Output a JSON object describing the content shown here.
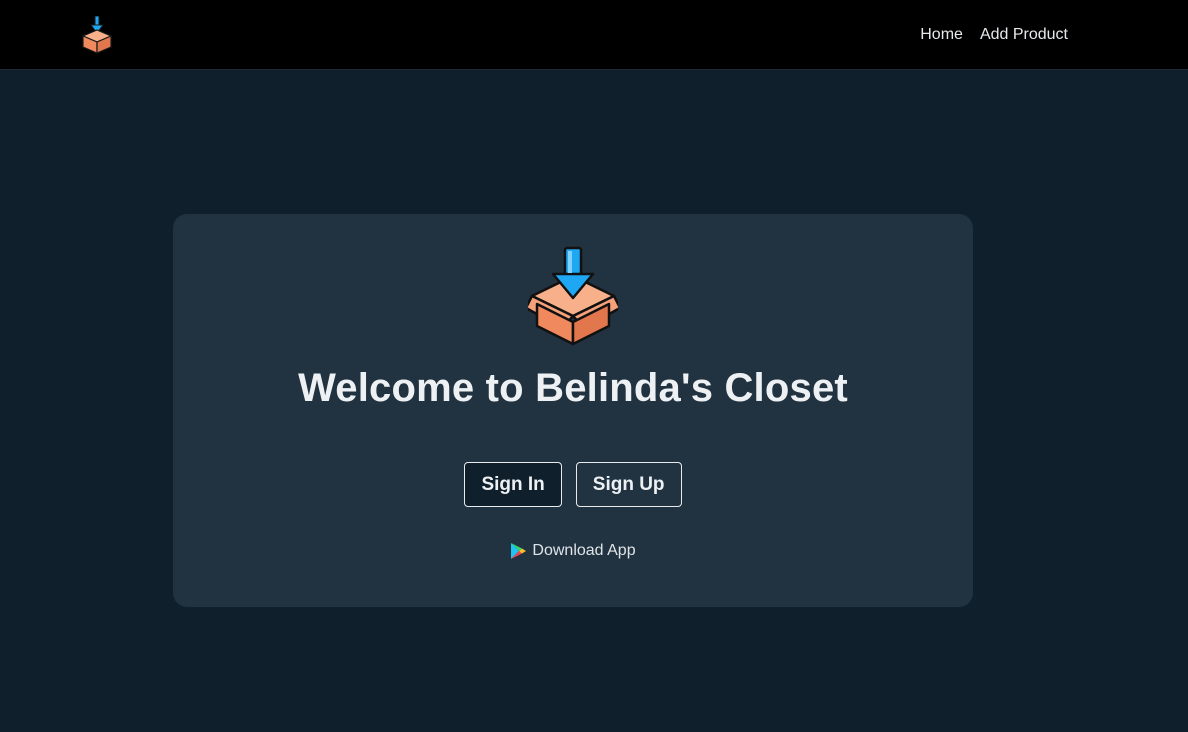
{
  "header": {
    "logo_icon": "box-download-icon",
    "nav": [
      {
        "label": "Home"
      },
      {
        "label": "Add Product"
      }
    ]
  },
  "main": {
    "hero_icon": "box-download-icon",
    "title": "Welcome to Belinda's Closet",
    "buttons": {
      "sign_in": "Sign In",
      "sign_up": "Sign Up"
    },
    "download": {
      "icon": "google-play-icon",
      "label": "Download App"
    }
  },
  "colors": {
    "background": "#0f1f2c",
    "topbar": "#000000",
    "card": "#213240",
    "text": "#eef1f4",
    "box_orange": "#f0895e",
    "arrow_blue": "#1ea7f2"
  }
}
